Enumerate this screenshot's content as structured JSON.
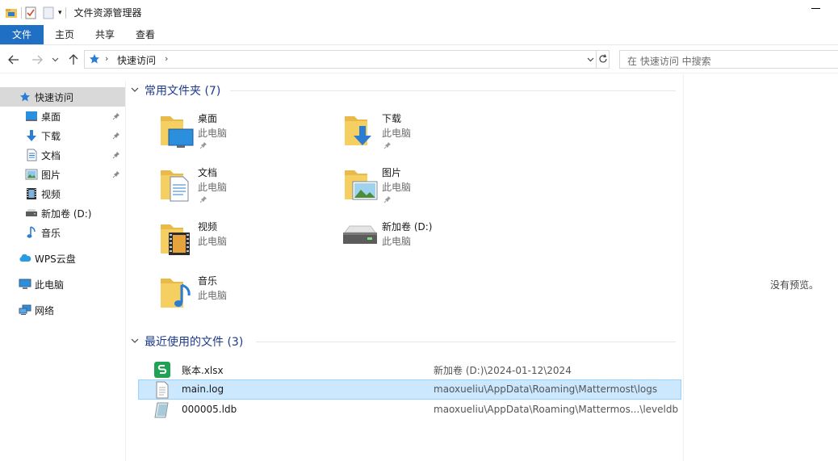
{
  "window": {
    "title": "文件资源管理器"
  },
  "ribbon": {
    "tabs": [
      "文件",
      "主页",
      "共享",
      "查看"
    ]
  },
  "address": {
    "path": "快速访问",
    "search_placeholder": "在 快速访问 中搜索"
  },
  "sidebar": {
    "items": [
      {
        "label": "快速访问",
        "icon": "star-icon",
        "selected": true,
        "pinned": false
      },
      {
        "label": "桌面",
        "icon": "desktop-icon",
        "selected": false,
        "pinned": true
      },
      {
        "label": "下载",
        "icon": "download-icon",
        "selected": false,
        "pinned": true
      },
      {
        "label": "文档",
        "icon": "document-icon",
        "selected": false,
        "pinned": true
      },
      {
        "label": "图片",
        "icon": "picture-icon",
        "selected": false,
        "pinned": true
      },
      {
        "label": "视频",
        "icon": "video-icon",
        "selected": false,
        "pinned": false
      },
      {
        "label": "新加卷 (D:)",
        "icon": "drive-icon",
        "selected": false,
        "pinned": false
      },
      {
        "label": "音乐",
        "icon": "music-icon",
        "selected": false,
        "pinned": false
      },
      {
        "label": "WPS云盘",
        "icon": "cloud-icon",
        "selected": false,
        "pinned": false
      },
      {
        "label": "此电脑",
        "icon": "computer-icon",
        "selected": false,
        "pinned": false
      },
      {
        "label": "网络",
        "icon": "network-icon",
        "selected": false,
        "pinned": false
      }
    ]
  },
  "frequent": {
    "header": "常用文件夹 (7)",
    "folders": [
      {
        "name": "桌面",
        "location": "此电脑",
        "icon": "desktop-folder-icon",
        "pinned": true
      },
      {
        "name": "下载",
        "location": "此电脑",
        "icon": "download-folder-icon",
        "pinned": true
      },
      {
        "name": "文档",
        "location": "此电脑",
        "icon": "documents-folder-icon",
        "pinned": true
      },
      {
        "name": "图片",
        "location": "此电脑",
        "icon": "pictures-folder-icon",
        "pinned": true
      },
      {
        "name": "视频",
        "location": "此电脑",
        "icon": "videos-folder-icon",
        "pinned": false
      },
      {
        "name": "新加卷 (D:)",
        "location": "此电脑",
        "icon": "drive-icon",
        "pinned": false
      },
      {
        "name": "音乐",
        "location": "此电脑",
        "icon": "music-folder-icon",
        "pinned": false
      }
    ]
  },
  "recent": {
    "header": "最近使用的文件 (3)",
    "files": [
      {
        "name": "账本.xlsx",
        "path": "新加卷 (D:)\\2024-01-12\\2024",
        "icon": "spreadsheet-icon",
        "selected": false
      },
      {
        "name": "main.log",
        "path": "maoxueliu\\AppData\\Roaming\\Mattermost\\logs",
        "icon": "text-file-icon",
        "selected": true
      },
      {
        "name": "000005.ldb",
        "path": "maoxueliu\\AppData\\Roaming\\Mattermos...\\leveldb",
        "icon": "ldb-file-icon",
        "selected": false
      }
    ]
  },
  "preview": {
    "text": "没有预览。"
  },
  "colors": {
    "accent": "#1f6fc4",
    "selection": "#cce8ff",
    "group_header": "#1e3a8a",
    "folder": "#f3c654"
  }
}
